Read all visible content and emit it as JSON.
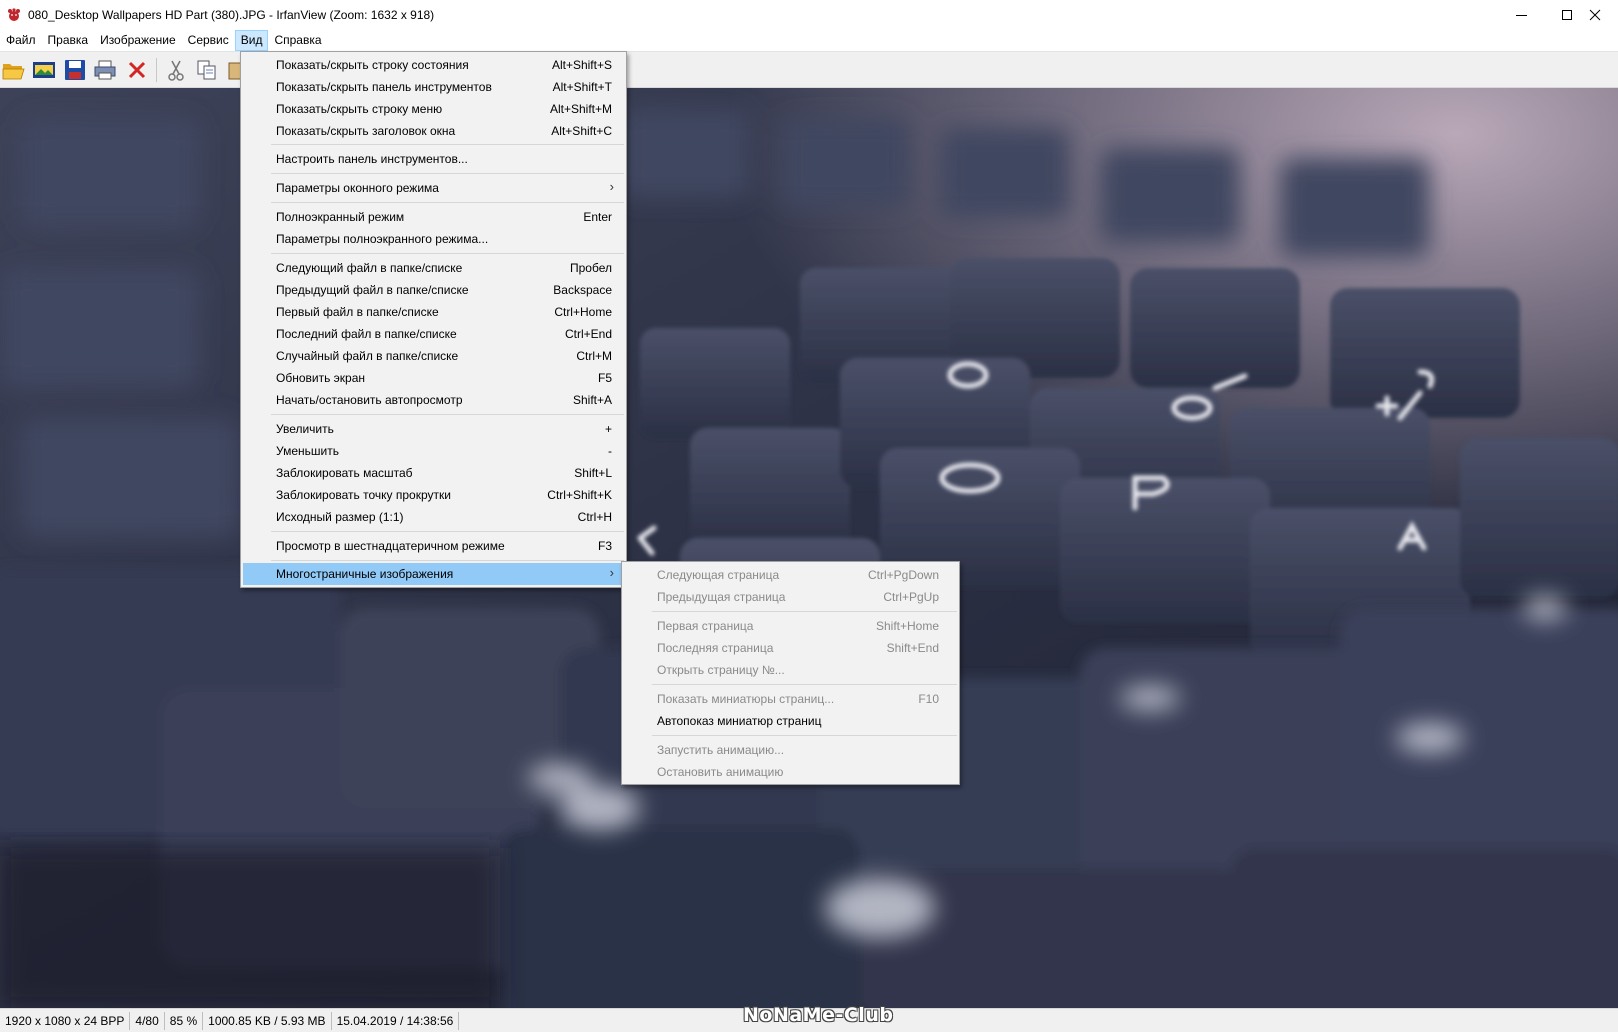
{
  "window": {
    "title": "080_Desktop Wallpapers  HD Part (380).JPG - IrfanView (Zoom: 1632 x 918)",
    "minimize_glyph": "—",
    "maximize_glyph": "☐",
    "close_glyph": "✕"
  },
  "menubar": {
    "items": [
      "Файл",
      "Правка",
      "Изображение",
      "Сервис",
      "Вид",
      "Справка"
    ],
    "active_index": 4
  },
  "toolbar": {
    "buttons": [
      "open-folder-icon",
      "slideshow-icon",
      "save-icon",
      "print-icon",
      "delete-icon",
      "cut-icon",
      "copy-icon",
      "paste-icon"
    ]
  },
  "view_menu": {
    "items": [
      {
        "label": "Показать/скрыть строку состояния",
        "shortcut": "Alt+Shift+S"
      },
      {
        "label": "Показать/скрыть панель инструментов",
        "shortcut": "Alt+Shift+T"
      },
      {
        "label": "Показать/скрыть строку меню",
        "shortcut": "Alt+Shift+M"
      },
      {
        "label": "Показать/скрыть заголовок окна",
        "shortcut": "Alt+Shift+C"
      },
      {
        "label": "Настроить панель инструментов...",
        "shortcut": ""
      },
      {
        "label": "Параметры оконного режима",
        "shortcut": "",
        "submenu": true
      },
      {
        "label": "Полноэкранный режим",
        "shortcut": "Enter"
      },
      {
        "label": "Параметры полноэкранного режима...",
        "shortcut": ""
      },
      {
        "label": "Следующий файл в папке/списке",
        "shortcut": "Пробел"
      },
      {
        "label": "Предыдущий файл в папке/списке",
        "shortcut": "Backspace"
      },
      {
        "label": "Первый файл в папке/списке",
        "shortcut": "Ctrl+Home"
      },
      {
        "label": "Последний файл в папке/списке",
        "shortcut": "Ctrl+End"
      },
      {
        "label": "Случайный файл в папке/списке",
        "shortcut": "Ctrl+M"
      },
      {
        "label": "Обновить экран",
        "shortcut": "F5"
      },
      {
        "label": "Начать/остановить автопросмотр",
        "shortcut": "Shift+A"
      },
      {
        "label": "Увеличить",
        "shortcut": "+"
      },
      {
        "label": "Уменьшить",
        "shortcut": "-"
      },
      {
        "label": "Заблокировать масштаб",
        "shortcut": "Shift+L"
      },
      {
        "label": "Заблокировать точку прокрутки",
        "shortcut": "Ctrl+Shift+K"
      },
      {
        "label": "Исходный размер (1:1)",
        "shortcut": "Ctrl+H"
      },
      {
        "label": "Просмотр в шестнадцатеричном режиме",
        "shortcut": "F3"
      },
      {
        "label": "Многостраничные изображения",
        "shortcut": "",
        "submenu": true
      }
    ],
    "submenu_arrow": "›"
  },
  "multipage_submenu": {
    "items": [
      {
        "label": "Следующая страница",
        "shortcut": "Ctrl+PgDown"
      },
      {
        "label": "Предыдущая страница",
        "shortcut": "Ctrl+PgUp"
      },
      {
        "label": "Первая страница",
        "shortcut": "Shift+Home"
      },
      {
        "label": "Последняя страница",
        "shortcut": "Shift+End"
      },
      {
        "label": "Открыть страницу №...",
        "shortcut": ""
      },
      {
        "label": "Показать миниатюры страниц...",
        "shortcut": "F10"
      },
      {
        "label": "Автопоказ миниатюр страниц",
        "shortcut": ""
      },
      {
        "label": "Запустить анимацию...",
        "shortcut": ""
      },
      {
        "label": "Остановить анимацию",
        "shortcut": ""
      }
    ]
  },
  "statusbar": {
    "cells": [
      "1920 x 1080 x 24 BPP",
      "4/80",
      "85 %",
      "1000.85 KB / 5.93 MB",
      "15.04.2019 / 14:38:56"
    ]
  },
  "watermark": "NoNaMe-Club",
  "colors": {
    "menu_highlight": "#91c9f7",
    "menubar_active": "#cce8ff",
    "disabled_text": "#8a8a8a"
  }
}
